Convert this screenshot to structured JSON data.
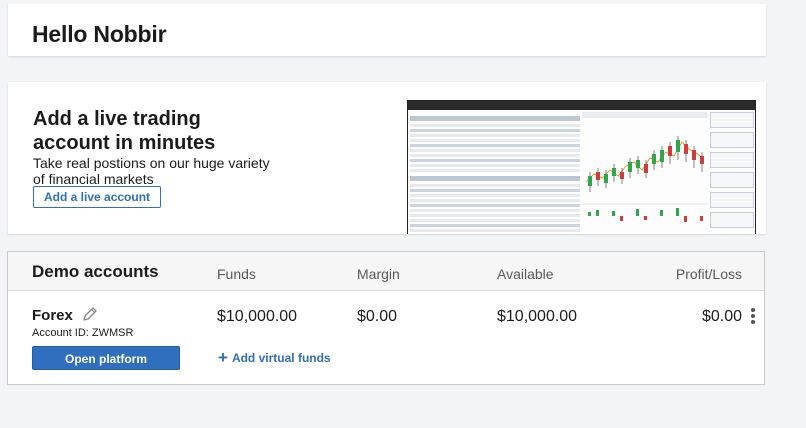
{
  "greeting": {
    "title": "Hello Nobbir"
  },
  "promo": {
    "title": "Add a live trading account in minutes",
    "subtitle": "Take real postions on our huge variety of financial markets",
    "button_label": "Add a live account"
  },
  "demo": {
    "title": "Demo accounts",
    "columns": {
      "funds": "Funds",
      "margin": "Margin",
      "available": "Available",
      "profit_loss": "Profit/Loss"
    },
    "account": {
      "name": "Forex",
      "account_id": "Account ID: ZWMSR",
      "funds": "$10,000.00",
      "margin": "$0.00",
      "available": "$10,000.00",
      "profit_loss": "$0.00"
    },
    "open_platform_label": "Open platform",
    "add_funds_label": "Add virtual funds"
  },
  "colors": {
    "accent": "#2f6fbd",
    "background": "#f3f4f5"
  },
  "icons": {
    "edit": "pencil-icon",
    "more": "more-vertical-icon",
    "add": "plus-icon"
  }
}
